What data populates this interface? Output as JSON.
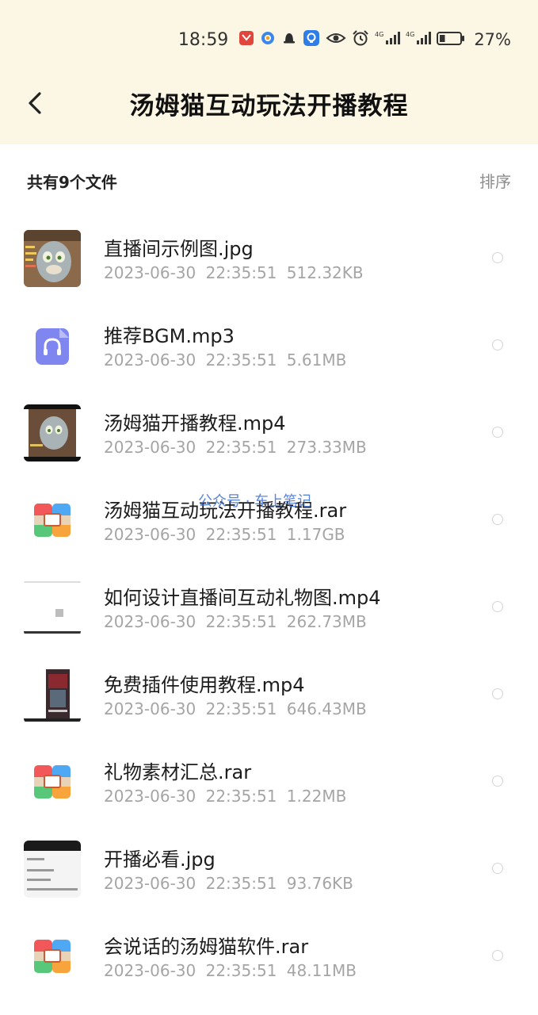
{
  "status_bar": {
    "time": "18:59",
    "battery_percent": "27%",
    "signal_label_1": "4G",
    "signal_label_2": "4G",
    "icons": [
      "app-red-icon",
      "browser-blue-icon",
      "qq-bell-icon",
      "app-blue-icon",
      "eye-icon",
      "alarm-icon",
      "signal-4g-icon",
      "signal-4g-icon",
      "battery-icon"
    ],
    "battery_level": 0.27
  },
  "header": {
    "back_icon": "chevron-left-icon",
    "title": "汤姆猫互动玩法开播教程"
  },
  "subbar": {
    "count_label": "共有9个文件",
    "sort_label": "排序"
  },
  "watermark": "公众号 · 车上笔记",
  "files": [
    {
      "name": "直播间示例图.jpg",
      "date": "2023-06-30",
      "time": "22:35:51",
      "size": "512.32KB",
      "icon": "image-thumbnail"
    },
    {
      "name": "推荐BGM.mp3",
      "date": "2023-06-30",
      "time": "22:35:51",
      "size": "5.61MB",
      "icon": "audio-file-icon"
    },
    {
      "name": "汤姆猫开播教程.mp4",
      "date": "2023-06-30",
      "time": "22:35:51",
      "size": "273.33MB",
      "icon": "video-thumbnail"
    },
    {
      "name": "汤姆猫互动玩法开播教程.rar",
      "date": "2023-06-30",
      "time": "22:35:51",
      "size": "1.17GB",
      "icon": "archive-file-icon"
    },
    {
      "name": "如何设计直播间互动礼物图.mp4",
      "date": "2023-06-30",
      "time": "22:35:51",
      "size": "262.73MB",
      "icon": "video-thumbnail"
    },
    {
      "name": "免费插件使用教程.mp4",
      "date": "2023-06-30",
      "time": "22:35:51",
      "size": "646.43MB",
      "icon": "video-thumbnail"
    },
    {
      "name": "礼物素材汇总.rar",
      "date": "2023-06-30",
      "time": "22:35:51",
      "size": "1.22MB",
      "icon": "archive-file-icon"
    },
    {
      "name": "开播必看.jpg",
      "date": "2023-06-30",
      "time": "22:35:51",
      "size": "93.76KB",
      "icon": "image-thumbnail"
    },
    {
      "name": "会说话的汤姆猫软件.rar",
      "date": "2023-06-30",
      "time": "22:35:51",
      "size": "48.11MB",
      "icon": "archive-file-icon"
    }
  ],
  "colors": {
    "header_bg": "#fcf7e4",
    "meta_text": "#a5a5a5",
    "audio_icon": "#7f86f0",
    "archive_red": "#f2585a",
    "archive_blue": "#4fa8f3",
    "archive_green": "#59c779",
    "archive_orange": "#f7a43c"
  }
}
